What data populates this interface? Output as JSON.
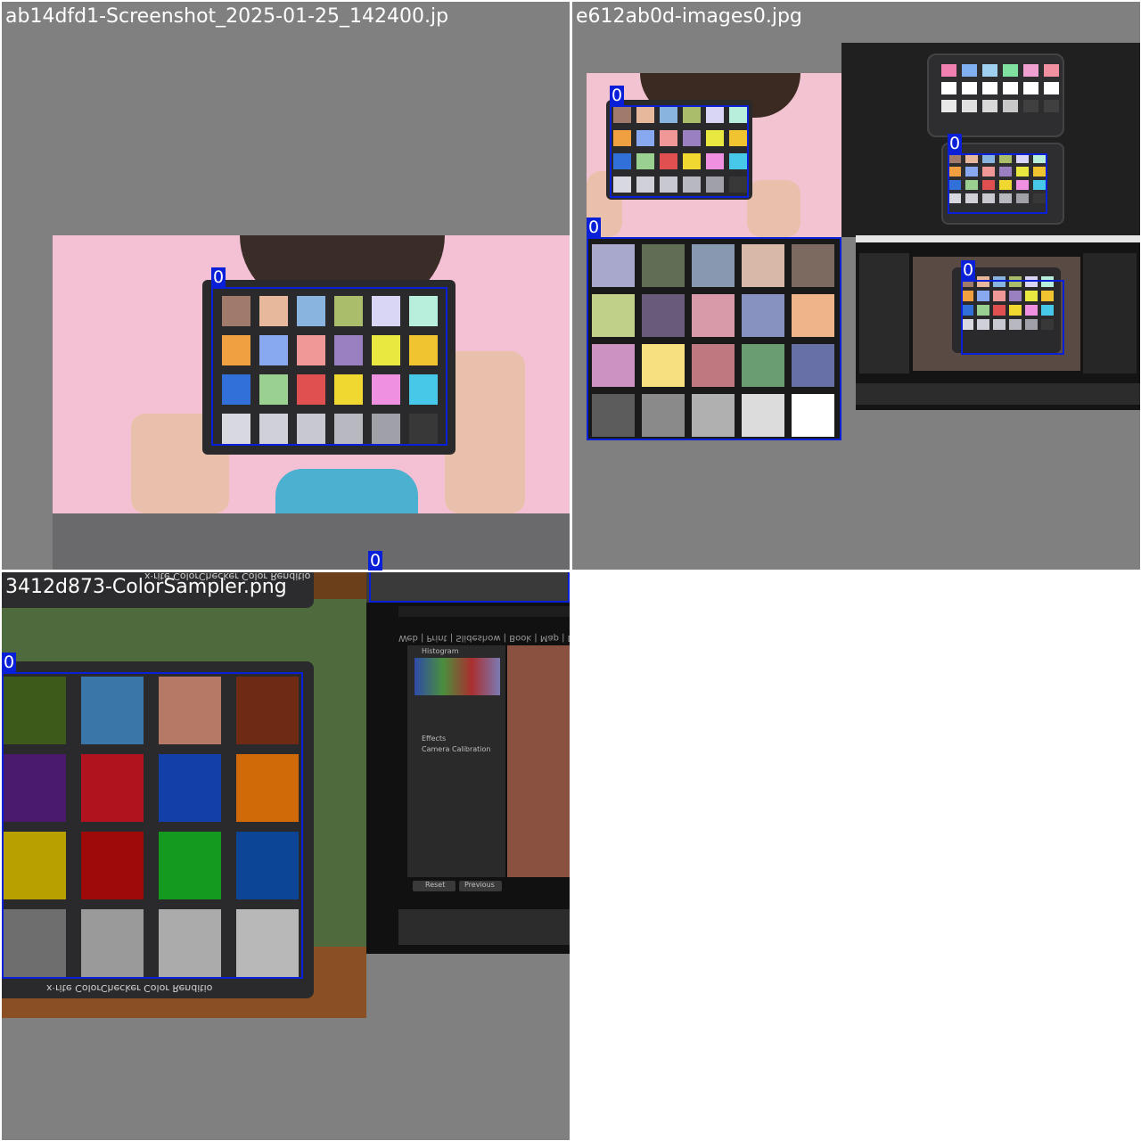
{
  "tiles": [
    {
      "filename": "ab14dfd1-Screenshot_2025-01-25_142400.jp"
    },
    {
      "filename": "e612ab0d-images0.jpg"
    },
    {
      "filename": "3412d873-ColorSampler.png"
    }
  ],
  "detection": {
    "class_label": "0",
    "box_color": "#0a1fd8"
  },
  "t3_texts": {
    "brand_top": "x·rite ColorChecker  Color Renditio",
    "brand_bottom": "x·rite ColorChecker  Color Renditio",
    "lr_menu": "Web | Print | Slideshow | Book | Map | D",
    "lr_histogram": "Histogram",
    "lr_effects": "Effects",
    "lr_calibration": "Camera Calibration",
    "lr_reset": "Reset",
    "lr_previous": "Previous"
  },
  "colors": {
    "tile_bg": "#808080",
    "chart_t1": [
      "#a07a6a",
      "#e8b89c",
      "#8ab4e0",
      "#a9bd6a",
      "#d8d6f4",
      "#b8eedc",
      "#f0a040",
      "#88a8f0",
      "#f09898",
      "#9a80c0",
      "#e8e840",
      "#f0c430",
      "#3070d8",
      "#9ad090",
      "#e05050",
      "#f0d830",
      "#f090e0",
      "#48c8e8",
      "#d8d8e0",
      "#d0d0d8",
      "#c8c8d0",
      "#b8b8c0",
      "#a0a0a8",
      "#383838"
    ],
    "chart_t2": [
      "#a8a8cc",
      "#5f6e55",
      "#8898b0",
      "#d8b8a8",
      "#7c6a60",
      "#c0d088",
      "#6a5a7a",
      "#d89aa8",
      "#8892c0",
      "#f0b48a",
      "#cc92c0",
      "#f6e080",
      "#c07880",
      "#6a9e70",
      "#6870a8",
      "#5c5c5c",
      "#8a8a8a",
      "#b0b0b0",
      "#dcdcdc",
      "#ffffff"
    ],
    "chart_t3": [
      "#3d5a1a",
      "#3a77a8",
      "#b47a66",
      "#6e2a12",
      "#4a1a6e",
      "#b0121e",
      "#1040a8",
      "#d06a08",
      "#b8a000",
      "#9e0a0a",
      "#159a20",
      "#0c4496",
      "#6e6e6e",
      "#9a9a9a",
      "#ababab",
      "#b8b8b8"
    ]
  }
}
